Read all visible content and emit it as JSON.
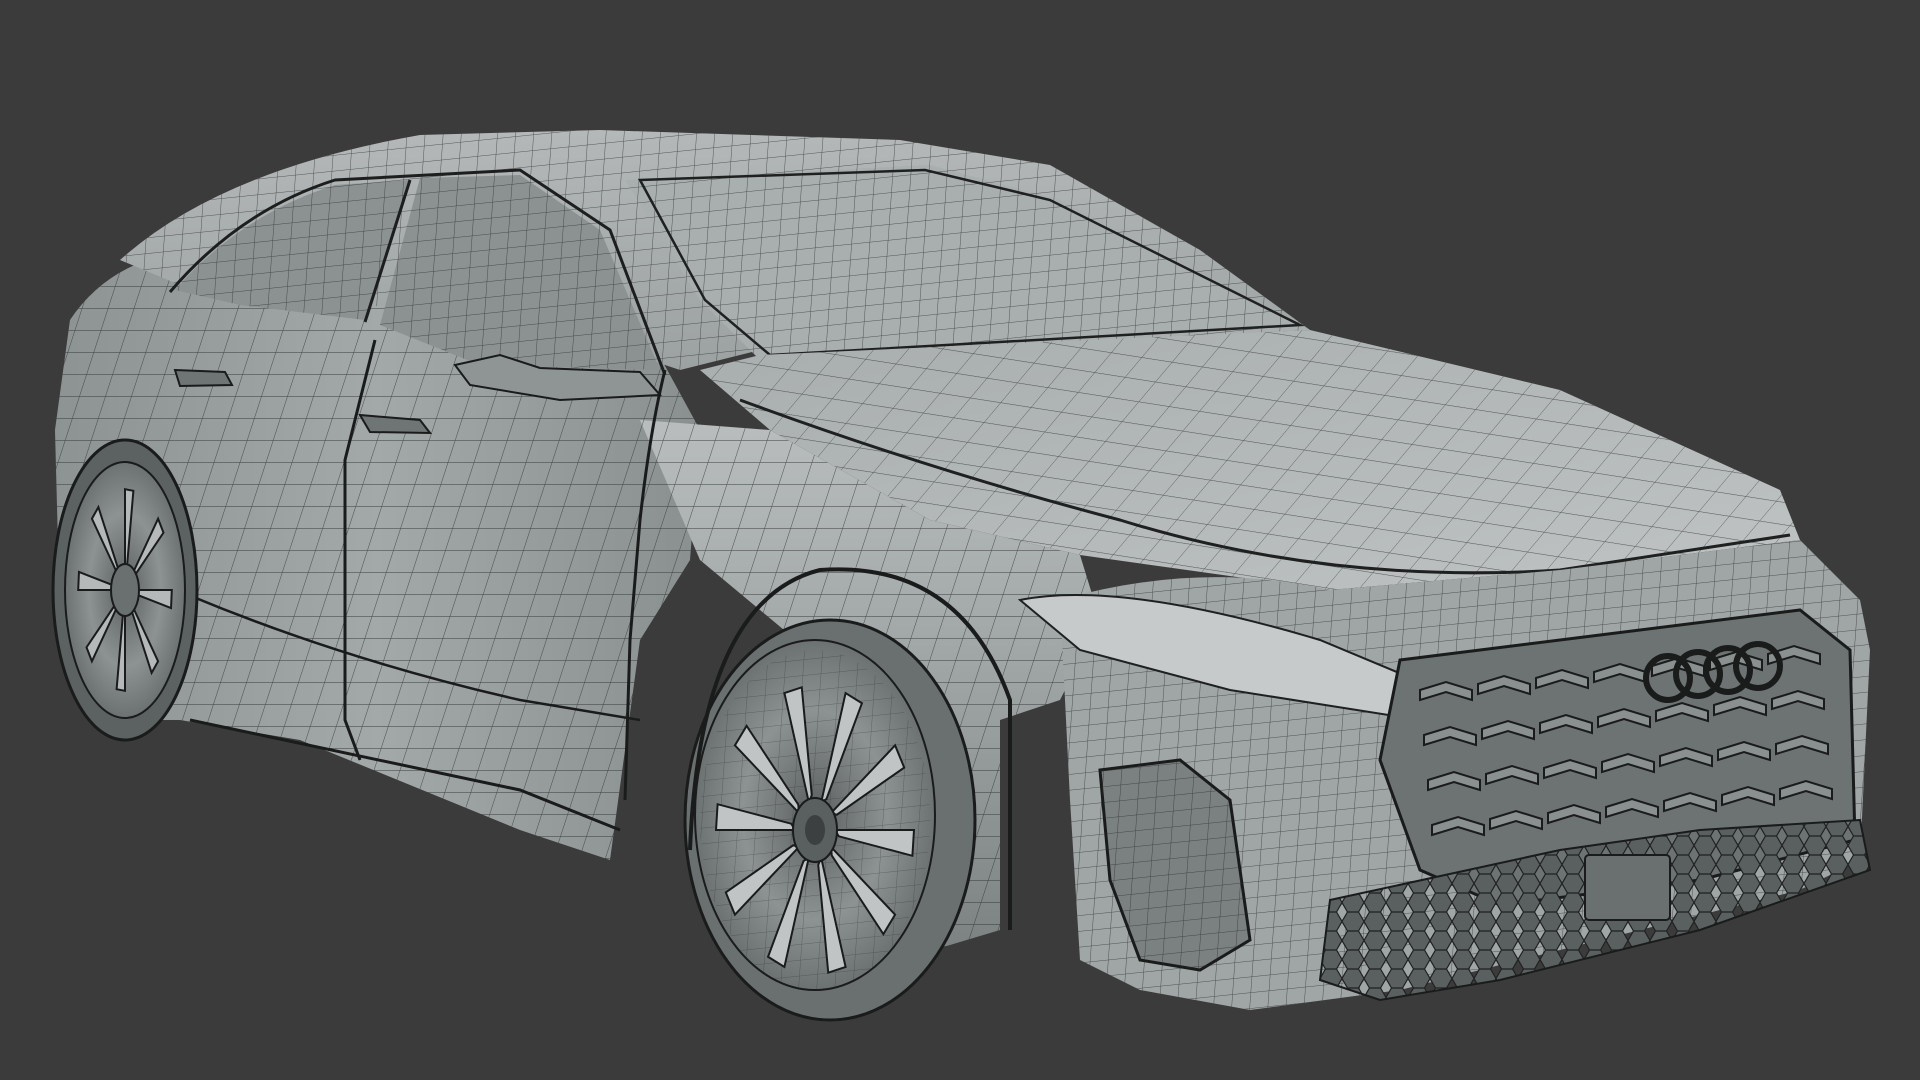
{
  "viewport": {
    "background_color": "#3b3b3b",
    "render_mode": "wireframe-on-shaded"
  },
  "model": {
    "subject": "car",
    "badge_icon": "four-rings-logo-icon",
    "body_color": "#9ea3a3",
    "wire_color": "#2a2c2c",
    "shade_light": "#c9cccc",
    "shade_dark": "#6f7474"
  }
}
